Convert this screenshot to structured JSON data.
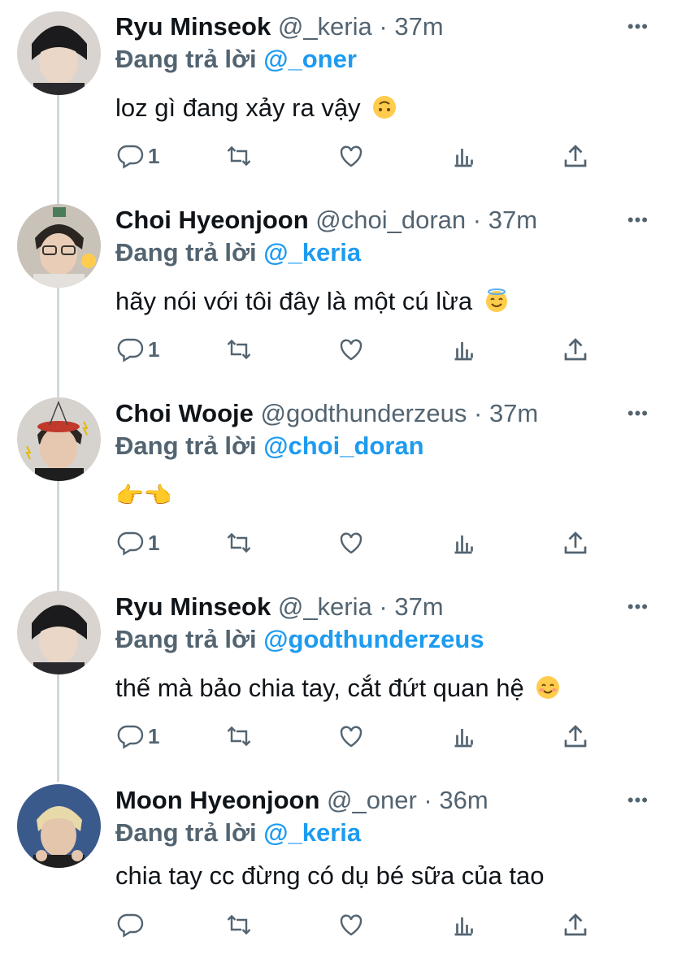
{
  "reply_label": "Đang trả lời",
  "tweets": [
    {
      "name": "Ryu Minseok",
      "handle": "@_keria",
      "dot": "·",
      "time": "37m",
      "mention": "@_oner",
      "text": "loz gì đang xảy ra vậy",
      "emoji": "upside-down-face",
      "reply_count": "1"
    },
    {
      "name": "Choi Hyeonjoon",
      "handle": "@choi_doran",
      "dot": "·",
      "time": "37m",
      "mention": "@_keria",
      "text": "hãy nói với tôi đây là một cú lừa",
      "emoji": "smiling-face-with-halo",
      "reply_count": "1"
    },
    {
      "name": "Choi Wooje",
      "handle": "@godthunderzeus",
      "dot": "·",
      "time": "37m",
      "mention": "@choi_doran",
      "text": "👉👈",
      "emoji": "pointing-fingers",
      "reply_count": "1"
    },
    {
      "name": "Ryu Minseok",
      "handle": "@_keria",
      "dot": "·",
      "time": "37m",
      "mention": "@godthunderzeus",
      "text": "thế mà bảo chia tay, cắt đứt quan hệ",
      "emoji": "smiling-face",
      "reply_count": "1"
    },
    {
      "name": "Moon Hyeonjoon",
      "handle": "@_oner",
      "dot": "·",
      "time": "36m",
      "mention": "@_keria",
      "text": "chia tay cc đừng có dụ bé sữa của tao",
      "emoji": "",
      "reply_count": ""
    }
  ],
  "icons": [
    "reply-icon",
    "retweet-icon",
    "like-icon",
    "stats-icon",
    "share-icon",
    "more-icon"
  ],
  "colors": {
    "link": "#1d9bf0",
    "secondary": "#536471",
    "text": "#0f1419",
    "thread_line": "#cfd9de"
  }
}
